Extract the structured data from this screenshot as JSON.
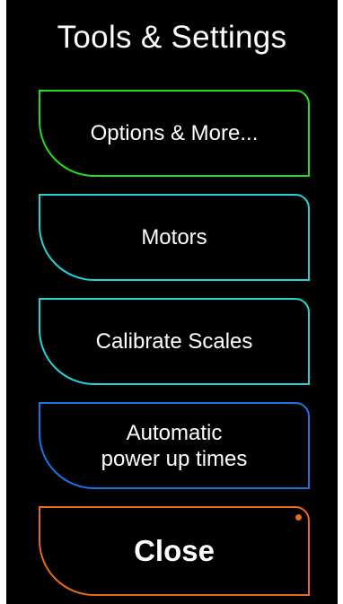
{
  "header": {
    "title": "Tools & Settings"
  },
  "menu": {
    "options": {
      "label": "Options & More...",
      "color": "#22dd22"
    },
    "motors": {
      "label": "Motors",
      "color": "#22d3d8"
    },
    "calibrate": {
      "label": "Calibrate Scales",
      "color": "#22d3d8"
    },
    "power": {
      "label": "Automatic\npower up times",
      "color": "#1a73e8"
    },
    "close": {
      "label": "Close",
      "color": "#e86a1a"
    }
  }
}
